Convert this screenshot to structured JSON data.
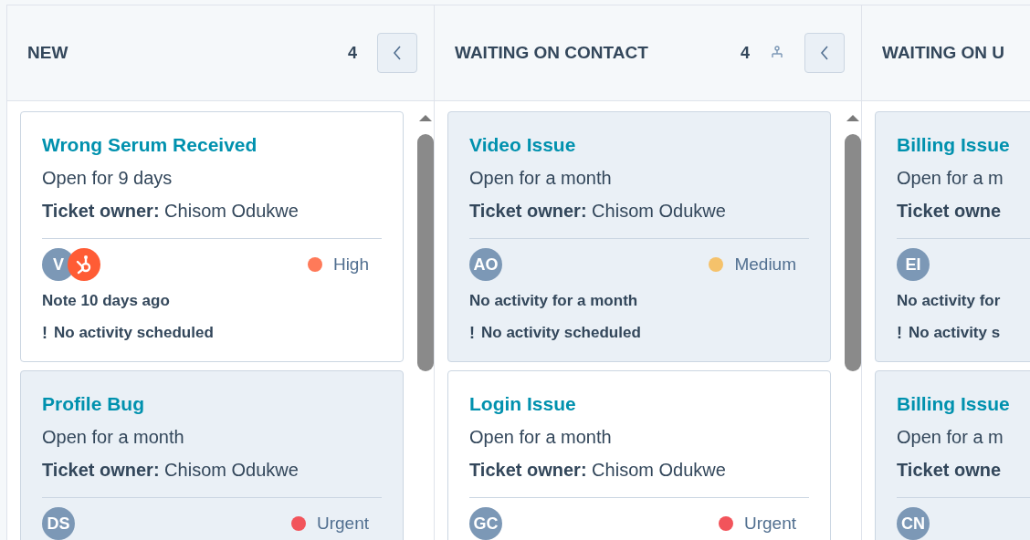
{
  "columns": [
    {
      "title": "NEW",
      "count": "4",
      "assign_icon": false,
      "cards": [
        {
          "title": "Wrong Serum Received",
          "open": "Open for 9 days",
          "owner_label": "Ticket owner:",
          "owner": "Chisom Odukwe",
          "highlighted": false,
          "avatars": [
            {
              "kind": "initials",
              "text": "V"
            },
            {
              "kind": "logo"
            }
          ],
          "priority": {
            "label": "High",
            "color": "#ff7a59"
          },
          "activity": "Note 10 days ago",
          "warning_mark": "!",
          "scheduled": "No activity scheduled"
        },
        {
          "title": "Profile Bug",
          "open": "Open for a month",
          "owner_label": "Ticket owner:",
          "owner": "Chisom Odukwe",
          "highlighted": true,
          "avatars": [
            {
              "kind": "initials",
              "text": "DS"
            }
          ],
          "priority": {
            "label": "Urgent",
            "color": "#f2545b"
          }
        }
      ]
    },
    {
      "title": "WAITING ON CONTACT",
      "count": "4",
      "assign_icon": true,
      "cards": [
        {
          "title": "Video Issue",
          "open": "Open for a month",
          "owner_label": "Ticket owner:",
          "owner": "Chisom Odukwe",
          "highlighted": true,
          "avatars": [
            {
              "kind": "initials",
              "text": "AO"
            }
          ],
          "priority": {
            "label": "Medium",
            "color": "#f5c26b"
          },
          "activity": "No activity for a month",
          "warning_mark": "!",
          "scheduled": "No activity scheduled"
        },
        {
          "title": "Login Issue",
          "open": "Open for a month",
          "owner_label": "Ticket owner:",
          "owner": "Chisom Odukwe",
          "highlighted": false,
          "avatars": [
            {
              "kind": "initials",
              "text": "GC"
            }
          ],
          "priority": {
            "label": "Urgent",
            "color": "#f2545b"
          }
        }
      ]
    },
    {
      "title": "WAITING ON U",
      "cards": [
        {
          "title": "Billing Issue",
          "open": "Open for a m",
          "owner_label": "Ticket owne",
          "highlighted": true,
          "avatars": [
            {
              "kind": "initials",
              "text": "EI"
            }
          ],
          "activity": "No activity for",
          "warning_mark": "!",
          "scheduled": "No activity s"
        },
        {
          "title": "Billing Issue",
          "open": "Open for a m",
          "owner_label": "Ticket owne",
          "highlighted": true,
          "avatars": [
            {
              "kind": "initials",
              "text": "CN"
            }
          ]
        }
      ]
    }
  ]
}
